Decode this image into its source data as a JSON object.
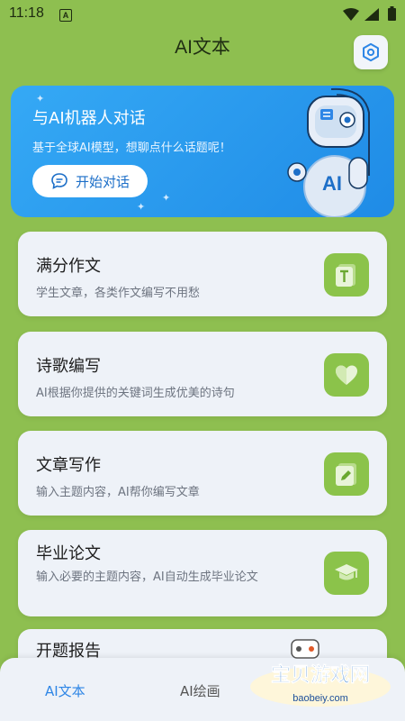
{
  "status_bar": {
    "time": "11:18",
    "notification_letter": "A"
  },
  "header": {
    "title": "AI文本",
    "settings_icon": "settings-icon"
  },
  "banner": {
    "title": "与AI机器人对话",
    "subtitle": "基于全球AI模型，想聊点什么话题呢！",
    "button_label": "开始对话",
    "robot_badge": "AI"
  },
  "cards": [
    {
      "title": "满分作文",
      "desc": "学生文章，各类作文编写不用愁",
      "icon": "text-document-icon"
    },
    {
      "title": "诗歌编写",
      "desc": "AI根据你提供的关键词生成优美的诗句",
      "icon": "heart-icon"
    },
    {
      "title": "文章写作",
      "desc": "输入主题内容，AI帮你编写文章",
      "icon": "pencil-icon"
    },
    {
      "title": "毕业论文",
      "desc": "输入必要的主题内容，AI自动生成毕业论文",
      "icon": "graduation-cap-icon"
    },
    {
      "title": "开题报告",
      "desc": ""
    }
  ],
  "bottom_nav": {
    "items": [
      "AI文本",
      "AI绘画"
    ],
    "active": "AI文本"
  },
  "watermark": {
    "text": "宝贝游戏网",
    "url": "baobeiy.com"
  },
  "colors": {
    "background": "#8ebf50",
    "accent_blue": "#2e86e6",
    "icon_green": "#8bc34a",
    "card_bg": "#eef2f8"
  }
}
